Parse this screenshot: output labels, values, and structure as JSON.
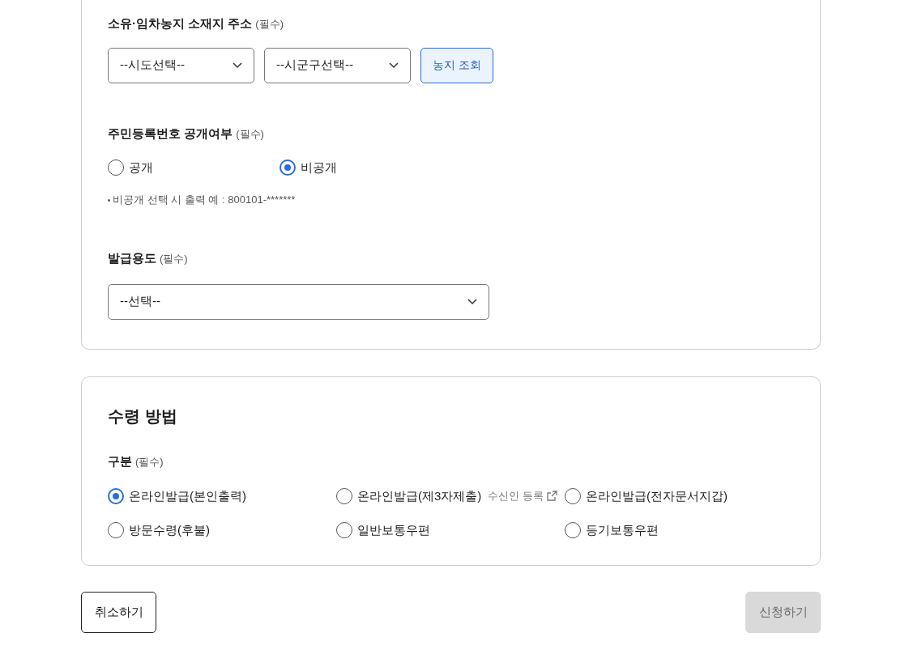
{
  "application_section": {
    "address": {
      "label": "소유·임차농지 소재지 주소",
      "required": "(필수)",
      "selects": [
        {
          "value": "--시도선택--"
        },
        {
          "value": "--시군구선택--"
        }
      ],
      "lookup_button": "농지 조회"
    },
    "id_disclosure": {
      "label": "주민등록번호 공개여부",
      "required": "(필수)",
      "options": [
        {
          "label": "공개",
          "selected": false
        },
        {
          "label": "비공개",
          "selected": true
        }
      ],
      "note": "비공개 선택 시 출력 예 : 800101-*******"
    },
    "purpose": {
      "label": "발급용도",
      "required": "(필수)",
      "select": {
        "value": "--선택--"
      }
    }
  },
  "receipt_section": {
    "title": "수령 방법",
    "label": "구분",
    "required": "(필수)",
    "options": [
      {
        "label": "온라인발급(본인출력)",
        "selected": true
      },
      {
        "label": "온라인발급(제3자제출)",
        "selected": false,
        "link": "수신인 등록"
      },
      {
        "label": "온라인발급(전자문서지갑)",
        "selected": false
      },
      {
        "label": "방문수령(후불)",
        "selected": false
      },
      {
        "label": "일반보통우편",
        "selected": false
      },
      {
        "label": "등기보통우편",
        "selected": false
      }
    ]
  },
  "buttons": {
    "cancel": {
      "label": "취소하기",
      "disabled": false
    },
    "submit": {
      "label": "신청하기",
      "disabled": true
    }
  }
}
